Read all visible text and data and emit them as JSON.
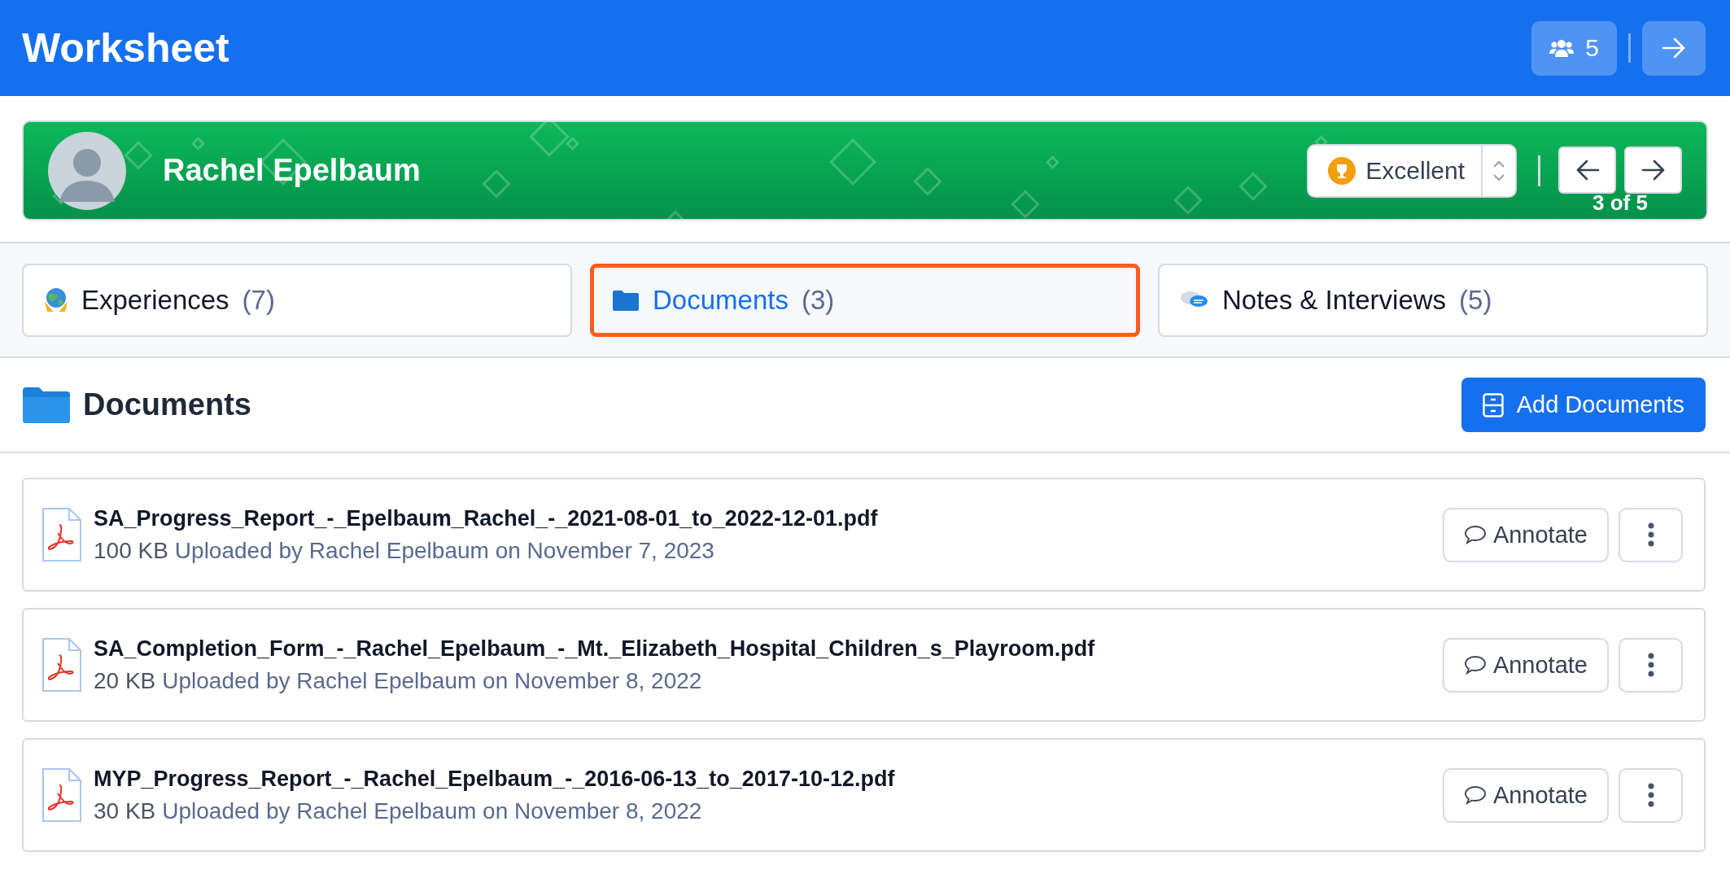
{
  "header": {
    "title": "Worksheet",
    "members_count": "5"
  },
  "student": {
    "name": "Rachel Epelbaum",
    "rating": "Excellent",
    "position": "3 of 5"
  },
  "tabs": [
    {
      "kind": "globe",
      "label": "Experiences",
      "count": "(7)",
      "selected": false
    },
    {
      "kind": "folder",
      "label": "Documents",
      "count": "(3)",
      "selected": true
    },
    {
      "kind": "chat",
      "label": "Notes & Interviews",
      "count": "(5)",
      "selected": false
    }
  ],
  "section": {
    "title": "Documents",
    "add_button": "Add Documents"
  },
  "documents": [
    {
      "filename": "SA_Progress_Report_-_Epelbaum_Rachel_-_2021-08-01_to_2022-12-01.pdf",
      "size": "100 KB",
      "uploaded": "Uploaded by Rachel Epelbaum on November 7, 2023",
      "annotate": "Annotate"
    },
    {
      "filename": "SA_Completion_Form_-_Rachel_Epelbaum_-_Mt._Elizabeth_Hospital_Children_s_Playroom.pdf",
      "size": "20 KB",
      "uploaded": "Uploaded by Rachel Epelbaum on November 8, 2022",
      "annotate": "Annotate"
    },
    {
      "filename": "MYP_Progress_Report_-_Rachel_Epelbaum_-_2016-06-13_to_2017-10-12.pdf",
      "size": "30 KB",
      "uploaded": "Uploaded by Rachel Epelbaum on November 8, 2022",
      "annotate": "Annotate"
    }
  ]
}
